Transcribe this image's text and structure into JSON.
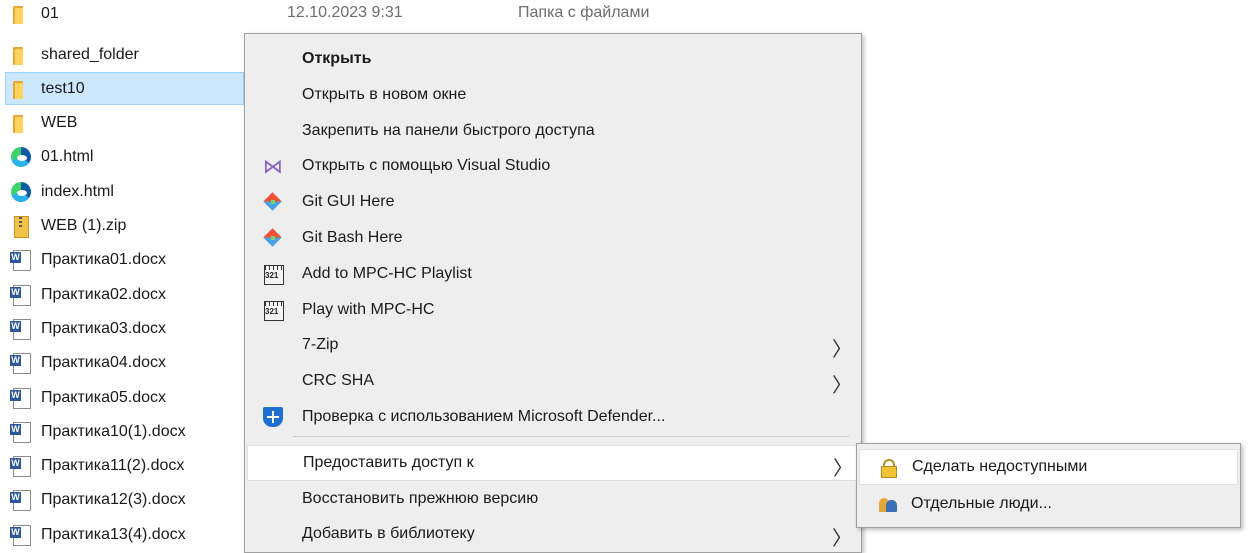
{
  "file_list": {
    "top_row": {
      "name": "01",
      "date": "12.10.2023 9:31",
      "type": "Папка с файлами"
    },
    "items": [
      {
        "name": "shared_folder",
        "icon": "folder-icon"
      },
      {
        "name": "test10",
        "icon": "folder-icon",
        "selected": true
      },
      {
        "name": "WEB",
        "icon": "folder-icon"
      },
      {
        "name": "01.html",
        "icon": "edge-icon"
      },
      {
        "name": "index.html",
        "icon": "edge-icon"
      },
      {
        "name": "WEB (1).zip",
        "icon": "zip-icon"
      },
      {
        "name": "Практика01.docx",
        "icon": "word-doc-icon"
      },
      {
        "name": "Практика02.docx",
        "icon": "word-doc-icon"
      },
      {
        "name": "Практика03.docx",
        "icon": "word-doc-icon"
      },
      {
        "name": "Практика04.docx",
        "icon": "word-doc-icon"
      },
      {
        "name": "Практика05.docx",
        "icon": "word-doc-icon"
      },
      {
        "name": "Практика10(1).docx",
        "icon": "word-doc-icon"
      },
      {
        "name": "Практика11(2).docx",
        "icon": "word-doc-icon"
      },
      {
        "name": "Практика12(3).docx",
        "icon": "word-doc-icon"
      },
      {
        "name": "Практика13(4).docx",
        "icon": "word-doc-icon"
      }
    ]
  },
  "context_menu": {
    "items": [
      {
        "label": "Открыть",
        "bold": true
      },
      {
        "label": "Открыть в новом окне"
      },
      {
        "label": "Закрепить на панели быстрого доступа"
      },
      {
        "label": "Открыть с помощью Visual Studio",
        "icon": "visual-studio-icon"
      },
      {
        "label": "Git GUI Here",
        "icon": "git-icon"
      },
      {
        "label": "Git Bash Here",
        "icon": "git-icon"
      },
      {
        "label": "Add to MPC-HC Playlist",
        "icon": "mpc-hc-icon"
      },
      {
        "label": "Play with MPC-HC",
        "icon": "mpc-hc-icon"
      },
      {
        "label": "7-Zip",
        "submenu": true
      },
      {
        "label": "CRC SHA",
        "submenu": true
      },
      {
        "label": "Проверка с использованием Microsoft Defender...",
        "icon": "defender-shield-icon"
      },
      {
        "label": "Предоставить доступ к",
        "submenu": true,
        "highlighted": true
      },
      {
        "label": "Восстановить прежнюю версию"
      },
      {
        "label": "Добавить в библиотеку",
        "submenu": true
      }
    ],
    "arrow_glyph": "〉"
  },
  "submenu": {
    "items": [
      {
        "label": "Сделать недоступными",
        "icon": "lock-icon",
        "highlighted": true
      },
      {
        "label": "Отдельные люди...",
        "icon": "people-icon"
      }
    ]
  }
}
